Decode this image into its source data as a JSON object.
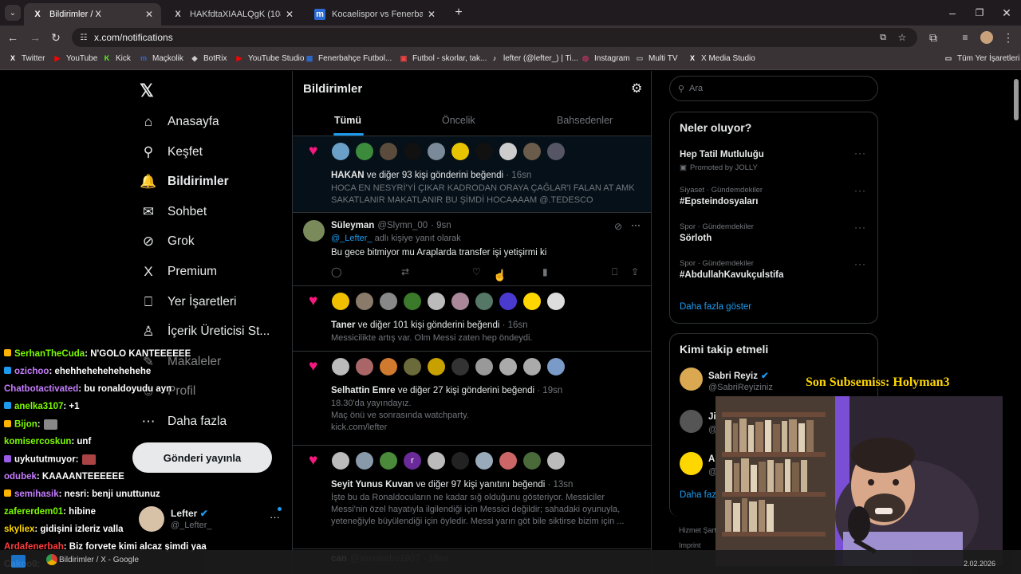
{
  "tabs": [
    {
      "icon": "X",
      "title": "Bildirimler / X",
      "active": true
    },
    {
      "icon": "X",
      "title": "HAKfdtaXIAALQgK (1080×1350)",
      "active": false
    },
    {
      "icon": "m",
      "title": "Kocaelispor vs Fenerbahçe, 02.0",
      "active": false
    }
  ],
  "address": "x.com/notifications",
  "bookmarks": [
    {
      "icon": "X",
      "label": "Twitter",
      "color": "#ffffff"
    },
    {
      "icon": "▶",
      "label": "YouTube",
      "color": "#ff0000"
    },
    {
      "icon": "K",
      "label": "Kick",
      "color": "#53fc18"
    },
    {
      "icon": "m",
      "label": "Maçkolik",
      "color": "#2a6bd6"
    },
    {
      "icon": "◆",
      "label": "BotRix",
      "color": "#cccccc"
    },
    {
      "icon": "▶",
      "label": "YouTube Studio",
      "color": "#ff0000"
    },
    {
      "icon": "▦",
      "label": "Fenerbahçe Futbol...",
      "color": "#2b6cd4"
    },
    {
      "icon": "▣",
      "label": "Futbol - skorlar, tak...",
      "color": "#e44"
    },
    {
      "icon": "♪",
      "label": "lefter (@lefter_) | Ti...",
      "color": "#ffffff"
    },
    {
      "icon": "◎",
      "label": "Instagram",
      "color": "#e1306c"
    },
    {
      "icon": "▭",
      "label": "Multi TV",
      "color": "#aaaaaa"
    },
    {
      "icon": "X",
      "label": "X Media Studio",
      "color": "#ffffff"
    }
  ],
  "bookmarks_folder": "Tüm Yer İşaretleri",
  "nav": [
    {
      "icon": "⌂",
      "label": "Anasayfa",
      "bold": false
    },
    {
      "icon": "⚲",
      "label": "Keşfet",
      "bold": false
    },
    {
      "icon": "🔔",
      "label": "Bildirimler",
      "bold": true
    },
    {
      "icon": "✉",
      "label": "Sohbet",
      "bold": false
    },
    {
      "icon": "⊘",
      "label": "Grok",
      "bold": false
    },
    {
      "icon": "X",
      "label": "Premium",
      "bold": false
    },
    {
      "icon": "⎕",
      "label": "Yer İşaretleri",
      "bold": false
    },
    {
      "icon": "♙",
      "label": "İçerik Üreticisi St...",
      "bold": false
    },
    {
      "icon": "✎",
      "label": "Makaleler",
      "bold": false
    },
    {
      "icon": "☺",
      "label": "Profil",
      "bold": false
    },
    {
      "icon": "⋯",
      "label": "Daha fazla",
      "bold": false
    }
  ],
  "post_button": "Gönderi yayınla",
  "account": {
    "name": "Lefter",
    "handle": "@_Lefter_"
  },
  "header": {
    "title": "Bildirimler"
  },
  "notif_tabs": [
    "Tümü",
    "Öncelik",
    "Bahsedenler"
  ],
  "notifications": [
    {
      "type": "like",
      "who": "HAKAN",
      "rest": " ve diğer 93 kişi gönderini beğendi",
      "time": " · 16sn",
      "text": [
        "HOCA EN NESYRİ'Yİ ÇIKAR KADRODAN ORAYA ÇAĞLAR'I FALAN AT AMK",
        "SAKATLANIR MAKATLANIR BU ŞİMDİ HOCAAAAM @.TEDESCO"
      ]
    },
    {
      "type": "reply",
      "name": "Süleyman",
      "handle": "@Slymn_00",
      "time": "· 9sn",
      "reply_to": "@_Lefter_",
      "reply_note": " adlı kişiye yanıt olarak",
      "text": "Bu gece bitmiyor mu Araplarda transfer işi yetişirmi ki"
    },
    {
      "type": "like",
      "who": "Taner",
      "rest": " ve diğer 101 kişi gönderini beğendi",
      "time": " · 16sn",
      "text": [
        "Messicilikte artış var. Olm Messi zaten hep öndeydi."
      ]
    },
    {
      "type": "like",
      "who": "Selhattin Emre",
      "rest": " ve diğer 27 kişi gönderini beğendi",
      "time": " · 19sn",
      "text": [
        "18.30'da yayındayız.",
        "Maç önü ve sonrasında watchparty.",
        "kick.com/lefter"
      ]
    },
    {
      "type": "like",
      "who": "Seyit Yunus Kuvan",
      "rest": " ve diğer 97 kişi yanıtını beğendi",
      "time": " · 13sn",
      "text": [
        "İşte bu da Ronaldocuların ne kadar sığ olduğunu gösteriyor. Messiciler",
        "Messi'nin özel hayatıyla ilgilendiği için Messici değildir; sahadaki oyunuyla,",
        "yeteneğiyle büyülendiği için öyledir. Messi yarın göt bile siktirse bizim için ..."
      ]
    },
    {
      "type": "partial",
      "name": "can",
      "handle": "@alexandro1907",
      "time": "· 18sn"
    }
  ],
  "search_placeholder": "Ara",
  "trends_title": "Neler oluyor?",
  "trends": [
    {
      "cat": "",
      "name": "Hep Tatil Mutluluğu",
      "promo": "Promoted by JOLLY"
    },
    {
      "cat": "Siyaset · Gündemdekiler",
      "name": "#Epsteindosyaları"
    },
    {
      "cat": "Spor · Gündemdekiler",
      "name": "Sörloth"
    },
    {
      "cat": "Spor · Gündemdekiler",
      "name": "#AbdullahKavukçuİstifa"
    }
  ],
  "show_more": "Daha fazla göster",
  "follow_title": "Kimi takip etmeli",
  "follow": [
    {
      "name": "Sabri Reyiz",
      "handle": "@SabriReyiziniz"
    },
    {
      "name": "Ji",
      "handle": "@"
    },
    {
      "name": "A",
      "handle": "@"
    }
  ],
  "follow_more": "Daha faz",
  "footer": [
    "Hizmet Şart",
    "Imprint"
  ],
  "chat": [
    {
      "user": "SerhanTheCuda",
      "msg": ": N'GOLO KANTEEEEEE",
      "color": "#7cfc00"
    },
    {
      "user": "ozichoo",
      "msg": ": ehehhehehehehehehe",
      "color": "#c77dff"
    },
    {
      "user": "Chatbotactivated",
      "msg": ": bu ronaldoyudu ayn",
      "color": "#c77dff"
    },
    {
      "user": "anelka3107",
      "msg": ": +1",
      "color": "#7cfc00"
    },
    {
      "user": "Bijon",
      "msg": ":",
      "color": "#7cfc00"
    },
    {
      "user": "komisercoskun",
      "msg": ": unf",
      "color": "#7cfc00"
    },
    {
      "user": "uykututmuyor",
      "msg": ":",
      "color": "#ffffff"
    },
    {
      "user": "odubek",
      "msg": ": KAAAANTEEEEEE",
      "color": "#c77dff"
    },
    {
      "user": "semihasik",
      "msg": ": nesri: benji unuttunuz",
      "color": "#c77dff"
    },
    {
      "user": "zafererdem01",
      "msg": ": hibine",
      "color": "#7cfc00"
    },
    {
      "user": "skyliex",
      "msg": ": gidişini izleriz valla",
      "color": "#ffd700"
    },
    {
      "user": "Ardafenerbah",
      "msg": ": Biz forvete kimi alcaz şimdi yaa",
      "color": "#ff3b3b"
    },
    {
      "user": "Cakoo0",
      "msg": ":",
      "color": "#ffffff"
    }
  ],
  "overlay_text": "Son Subsemiss: Holyman3",
  "taskbar": {
    "window": "Bildirimler / X - Google",
    "date": "2.02.2026"
  }
}
